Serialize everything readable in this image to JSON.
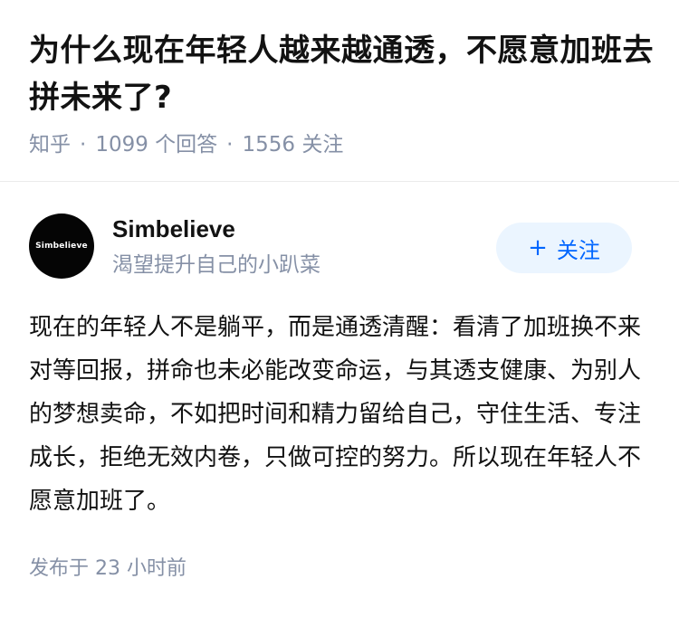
{
  "question": {
    "title": "为什么现在年轻人越来越通透，不愿意加班去拼未来了?",
    "source": "知乎",
    "separator": "·",
    "answer_count": "1099 个回答",
    "follower_count": "1556 关注"
  },
  "author": {
    "avatar_text": "Simbelieve",
    "name": "Simbelieve",
    "bio": "渴望提升自己的小趴菜",
    "follow_icon": "+",
    "follow_label": "关注"
  },
  "answer": {
    "content": "现在的年轻人不是躺平，而是通透清醒：看清了加班换不来对等回报，拼命也未必能改变命运，与其透支健康、为别人的梦想卖命，不如把时间和精力留给自己，守住生活、专注成长，拒绝无效内卷，只做可控的努力。所以现在年轻人不愿意加班了。",
    "published": "发布于 23 小时前"
  },
  "colors": {
    "text": "#121212",
    "muted": "#8590a6",
    "accent": "#0066ff",
    "accent_bg": "#ebf5ff"
  }
}
